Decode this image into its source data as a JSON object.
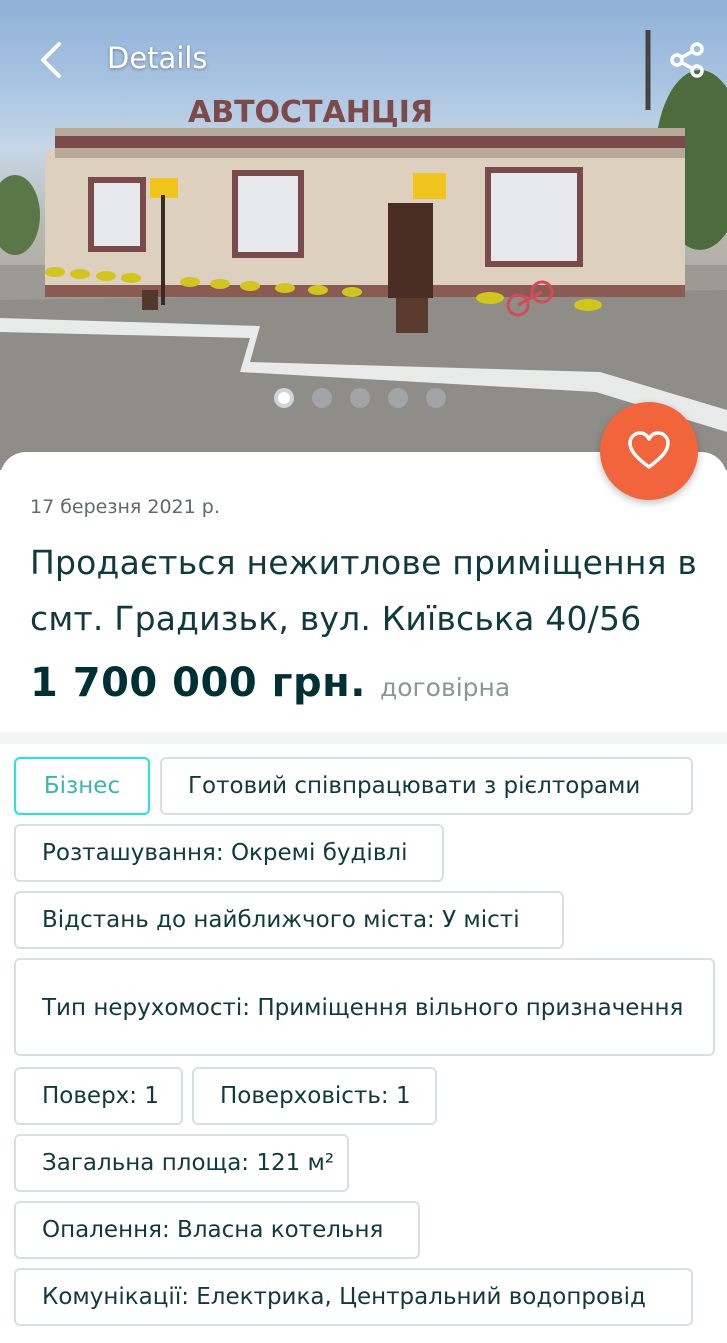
{
  "header": {
    "title": "Details",
    "back_icon": "chevron-left-icon",
    "share_icon": "share-icon"
  },
  "gallery": {
    "sign_text": "АВТОСТАНЦІЯ",
    "slide_count": 5,
    "active_slide": 1
  },
  "listing": {
    "date": "17 березня 2021 р.",
    "title": "Продається нежитлове приміщення в смт. Градизьк, вул. Київська 40/56",
    "price": "1 700 000 грн.",
    "price_note": "договірна",
    "favorite_icon": "heart-icon"
  },
  "tags": [
    "Бізнес",
    "Готовий співпрацювати з рієлторами",
    "Розташування: Окремі будівлі",
    "Відстань до найближчого міста: У місті",
    "Тип нерухомості: Приміщення вільного призначення",
    "Поверх: 1",
    "Поверховість: 1",
    "Загальна площа: 121 м²",
    "Опалення: Власна котельня",
    "Комунікації: Електрика, Центральний водопровід"
  ],
  "colors": {
    "accent": "#23e5db",
    "favorite": "#f2643c",
    "text": "#002f34"
  }
}
